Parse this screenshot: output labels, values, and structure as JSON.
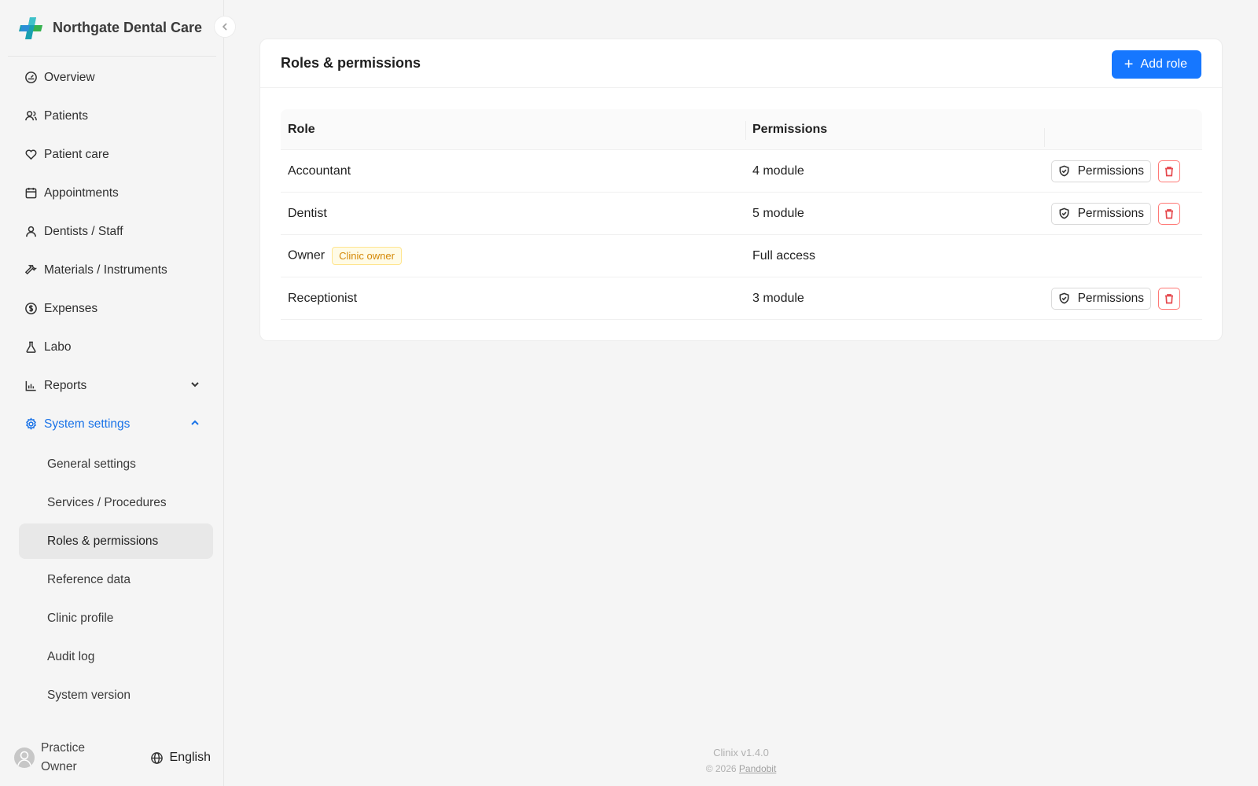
{
  "brand": {
    "name": "Northgate Dental Care"
  },
  "nav": {
    "items": [
      {
        "label": "Overview",
        "icon": "dashboard-icon"
      },
      {
        "label": "Patients",
        "icon": "users-icon"
      },
      {
        "label": "Patient care",
        "icon": "heart-icon"
      },
      {
        "label": "Appointments",
        "icon": "calendar-icon"
      },
      {
        "label": "Dentists / Staff",
        "icon": "user-icon"
      },
      {
        "label": "Materials / Instruments",
        "icon": "tool-icon"
      },
      {
        "label": "Expenses",
        "icon": "dollar-icon"
      },
      {
        "label": "Labo",
        "icon": "flask-icon"
      },
      {
        "label": "Reports",
        "icon": "chart-icon"
      },
      {
        "label": "System settings",
        "icon": "gear-icon"
      }
    ],
    "sub_items": [
      {
        "label": "General settings"
      },
      {
        "label": "Services / Procedures"
      },
      {
        "label": "Roles & permissions"
      },
      {
        "label": "Reference data"
      },
      {
        "label": "Clinic profile"
      },
      {
        "label": "Audit log"
      },
      {
        "label": "System version"
      }
    ],
    "active_sub": "Roles & permissions",
    "accent_color": "#1a73e8"
  },
  "user": {
    "name": "Practice Owner"
  },
  "language": {
    "label": "English"
  },
  "card": {
    "title": "Roles & permissions",
    "add_button": "Add role"
  },
  "table": {
    "headers": {
      "role": "Role",
      "permissions": "Permissions"
    },
    "rows": [
      {
        "role": "Accountant",
        "permissions": "4 module",
        "badge": "",
        "action": "Permissions"
      },
      {
        "role": "Dentist",
        "permissions": "5 module",
        "badge": "",
        "action": "Permissions"
      },
      {
        "role": "Owner",
        "permissions": "Full access",
        "badge": "Clinic owner",
        "action": ""
      },
      {
        "role": "Receptionist",
        "permissions": "3 module",
        "badge": "",
        "action": "Permissions"
      }
    ]
  },
  "footer": {
    "version": "Clinix v1.4.0",
    "copyright_prefix": "© 2026",
    "company": "Pandobit"
  }
}
